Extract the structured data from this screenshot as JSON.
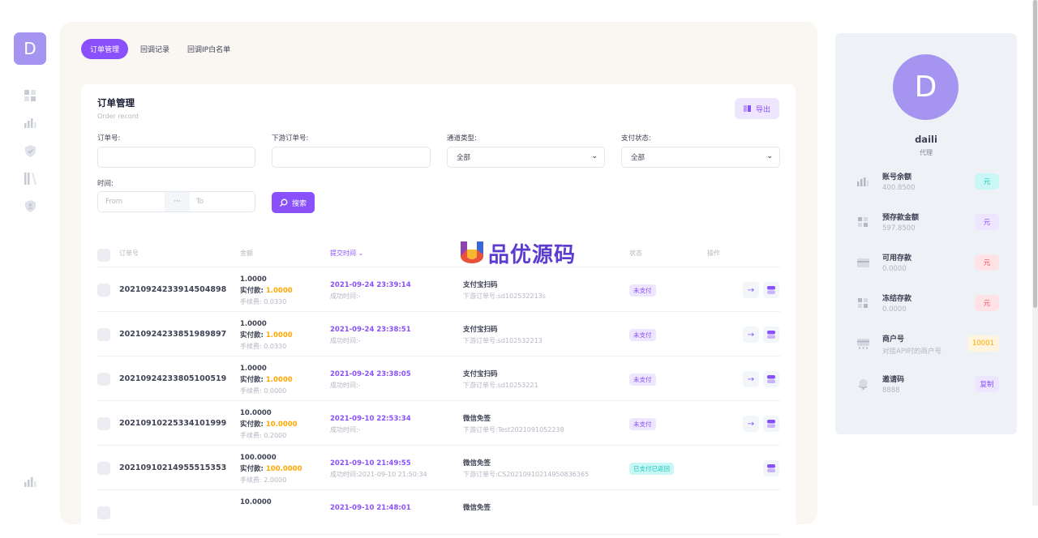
{
  "brand": {
    "letter": "D"
  },
  "tabs": [
    {
      "label": "订单管理",
      "active": true
    },
    {
      "label": "回调记录",
      "active": false
    },
    {
      "label": "回调IP白名单",
      "active": false
    }
  ],
  "card": {
    "title": "订单管理",
    "subtitle": "Order record",
    "export_label": "导出"
  },
  "filters": {
    "order_no_label": "订单号:",
    "downstream_no_label": "下游订单号:",
    "channel_label": "通道类型:",
    "channel_value": "全部",
    "pay_status_label": "支付状态:",
    "pay_status_value": "全部",
    "time_label": "时间:",
    "from_placeholder": "From",
    "sep": "···",
    "to_placeholder": "To",
    "search_label": "搜索"
  },
  "table": {
    "headers": {
      "order_no": "订单号",
      "amount": "金额",
      "submit_time": "提交时间",
      "status": "状态",
      "ops": "操作"
    },
    "rows": [
      {
        "order_no": "20210924233914504898",
        "amount": "1.0000",
        "paid_label": "实付款:",
        "paid": "1.0000",
        "fee": "手续费: 0.0330",
        "time": "2021-09-24 23:39:14",
        "success": "成功时间:-",
        "channel": "支付宝扫码",
        "downstream": "下游订单号:sd102532213s",
        "status": "未支付",
        "status_type": "unpaid"
      },
      {
        "order_no": "20210924233851989897",
        "amount": "1.0000",
        "paid_label": "实付款:",
        "paid": "1.0000",
        "fee": "手续费: 0.0330",
        "time": "2021-09-24 23:38:51",
        "success": "成功时间:-",
        "channel": "支付宝扫码",
        "downstream": "下游订单号:sd102532213",
        "status": "未支付",
        "status_type": "unpaid"
      },
      {
        "order_no": "20210924233805100519",
        "amount": "1.0000",
        "paid_label": "实付款:",
        "paid": "1.0000",
        "fee": "手续费: 0.0000",
        "time": "2021-09-24 23:38:05",
        "success": "成功时间:-",
        "channel": "支付宝扫码",
        "downstream": "下游订单号:sd10253221",
        "status": "未支付",
        "status_type": "unpaid"
      },
      {
        "order_no": "20210910225334101999",
        "amount": "10.0000",
        "paid_label": "实付款:",
        "paid": "10.0000",
        "fee": "手续费: 0.2000",
        "time": "2021-09-10 22:53:34",
        "success": "成功时间:-",
        "channel": "微信免签",
        "downstream": "下游订单号:Test2021091052238",
        "status": "未支付",
        "status_type": "unpaid"
      },
      {
        "order_no": "20210910214955515353",
        "amount": "100.0000",
        "paid_label": "实付款:",
        "paid": "100.0000",
        "fee": "手续费: 2.0000",
        "time": "2021-09-10 21:49:55",
        "success": "成功时间:2021-09-10 21:50:34",
        "channel": "微信免签",
        "downstream": "下游订单号:CS20210910214950836365",
        "status": "已支付已返回",
        "status_type": "paid"
      },
      {
        "order_no": "",
        "amount": "10.0000",
        "paid_label": "",
        "paid": "",
        "fee": "",
        "time": "2021-09-10 21:48:01",
        "success": "",
        "channel": "微信免签",
        "downstream": "",
        "status": "",
        "status_type": "unpaid"
      }
    ]
  },
  "watermark": {
    "text": "品优源码"
  },
  "profile": {
    "initial": "D",
    "name": "daili",
    "role": "代理",
    "stats": [
      {
        "label": "账号余额",
        "value": "400.8500",
        "pill": "元",
        "pill_bg": "#c9f7f5",
        "pill_fg": "#1bc5bd",
        "icon": "bar-chart-icon"
      },
      {
        "label": "预存款金额",
        "value": "597.8500",
        "pill": "元",
        "pill_bg": "#eee5ff",
        "pill_fg": "#8950fc",
        "icon": "grid-icon"
      },
      {
        "label": "可用存款",
        "value": "0.0000",
        "pill": "元",
        "pill_bg": "#ffe2e5",
        "pill_fg": "#f64e60",
        "icon": "card-icon"
      },
      {
        "label": "冻结存款",
        "value": "0.0000",
        "pill": "元",
        "pill_bg": "#ffe2e5",
        "pill_fg": "#f64e60",
        "icon": "grid-icon"
      },
      {
        "label": "商户号",
        "value": "对接API时的商户号",
        "pill": "10001",
        "pill_bg": "#fff4de",
        "pill_fg": "#ffa800",
        "icon": "terminal-icon"
      },
      {
        "label": "邀请码",
        "value": "8888",
        "pill": "复制",
        "pill_bg": "#eee5ff",
        "pill_fg": "#8950fc",
        "icon": "globe-icon"
      }
    ]
  },
  "colors": {
    "accent": "#8950fc",
    "warning": "#ffa800",
    "success": "#1bc5bd"
  }
}
